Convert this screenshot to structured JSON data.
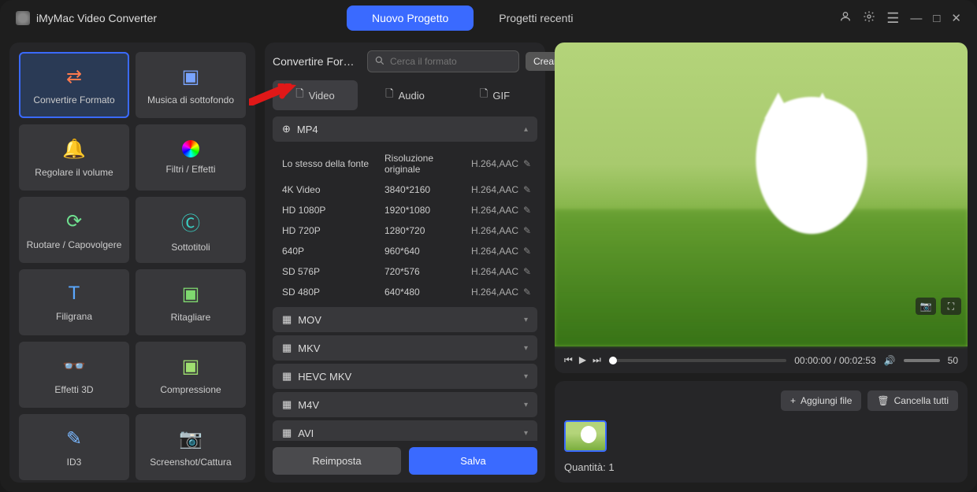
{
  "app": {
    "title": "iMyMac Video Converter"
  },
  "titlebar": {
    "new_project": "Nuovo Progetto",
    "recent_projects": "Progetti recenti"
  },
  "tools": [
    {
      "key": "convert",
      "label": "Convertire Formato",
      "icon": "ico-convert",
      "glyph": "⇄",
      "selected": true
    },
    {
      "key": "bgmusic",
      "label": "Musica di sottofondo",
      "icon": "ico-music",
      "glyph": "▣"
    },
    {
      "key": "volume",
      "label": "Regolare il volume",
      "icon": "ico-bell",
      "glyph": "🔔"
    },
    {
      "key": "filter",
      "label": "Filtri / Effetti",
      "icon": "ico-filter",
      "glyph": ""
    },
    {
      "key": "rotate",
      "label": "Ruotare / Capovolgere",
      "icon": "ico-rotate",
      "glyph": "⟳"
    },
    {
      "key": "subtitle",
      "label": "Sottotitoli",
      "icon": "ico-cc",
      "glyph": "Ⓒ"
    },
    {
      "key": "watermark",
      "label": "Filigrana",
      "icon": "ico-wm",
      "glyph": "T"
    },
    {
      "key": "crop",
      "label": "Ritagliare",
      "icon": "ico-crop",
      "glyph": "▣"
    },
    {
      "key": "3d",
      "label": "Effetti 3D",
      "icon": "ico-3d",
      "glyph": "👓"
    },
    {
      "key": "compress",
      "label": "Compressione",
      "icon": "ico-comp",
      "glyph": "▣"
    },
    {
      "key": "id3",
      "label": "ID3",
      "icon": "ico-id3",
      "glyph": "✎"
    },
    {
      "key": "screenshot",
      "label": "Screenshot/Cattura",
      "icon": "ico-shot",
      "glyph": "📷"
    }
  ],
  "mid": {
    "title": "Convertire Forma...",
    "search_placeholder": "Cerca il formato",
    "create": "Creare",
    "tabs": {
      "video": "Video",
      "audio": "Audio",
      "gif": "GIF"
    },
    "open_format": "MP4",
    "presets": [
      {
        "name": "Lo stesso della fonte",
        "res": "Risoluzione originale",
        "codec": "H.264,AAC"
      },
      {
        "name": "4K Video",
        "res": "3840*2160",
        "codec": "H.264,AAC"
      },
      {
        "name": "HD 1080P",
        "res": "1920*1080",
        "codec": "H.264,AAC"
      },
      {
        "name": "HD 720P",
        "res": "1280*720",
        "codec": "H.264,AAC"
      },
      {
        "name": "640P",
        "res": "960*640",
        "codec": "H.264,AAC"
      },
      {
        "name": "SD 576P",
        "res": "720*576",
        "codec": "H.264,AAC"
      },
      {
        "name": "SD 480P",
        "res": "640*480",
        "codec": "H.264,AAC"
      }
    ],
    "collapsed": [
      "MOV",
      "MKV",
      "HEVC MKV",
      "M4V",
      "AVI"
    ],
    "reset": "Reimposta",
    "save": "Salva"
  },
  "player": {
    "time": "00:00:00 / 00:02:53",
    "volume": "50"
  },
  "files": {
    "add": "Aggiungi file",
    "clear": "Cancella tutti",
    "quantity_label": "Quantità:",
    "quantity": "1"
  }
}
